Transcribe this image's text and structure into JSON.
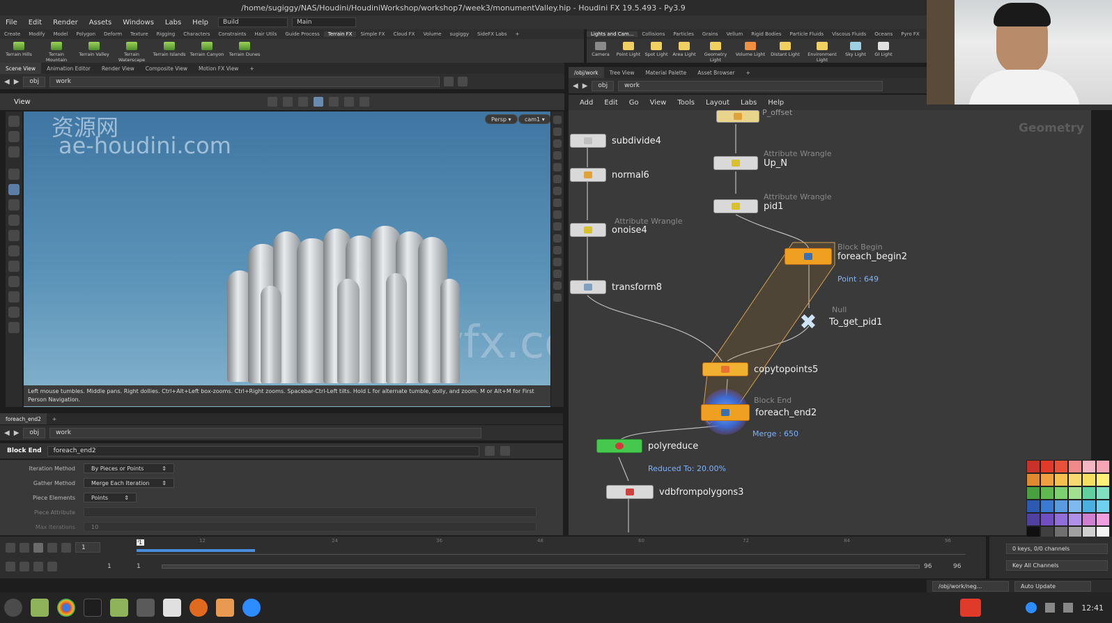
{
  "window": {
    "title": "/home/sugiggy/NAS/Houdini/HoudiniWorkshop/workshop7/week3/monumentValley.hip - Houdini FX 19.5.493 - Py3.9"
  },
  "menubar": {
    "items": [
      "File",
      "Edit",
      "Render",
      "Assets",
      "Windows",
      "Labs",
      "Help"
    ],
    "desktop": "Build",
    "context": "Main"
  },
  "shelf_left": {
    "tabs": [
      "Create",
      "Modify",
      "Model",
      "Polygon",
      "Deform",
      "Texture",
      "Rigging",
      "Characters",
      "Constraints",
      "Hair Utils",
      "Guide Process",
      "Terrain FX",
      "Simple FX",
      "Cloud FX",
      "Volume",
      "sugiggy",
      "SideFX Labs"
    ],
    "active_tab": "Terrain FX",
    "tools": [
      "Terrain Hills",
      "Terrain Mountain",
      "Terrain Valley",
      "Terrain Waterscape",
      "Terrain Islands",
      "Terrain Canyon",
      "Terrain Dunes"
    ]
  },
  "shelf_right": {
    "tabs": [
      "Lights and Cam...",
      "Collisions",
      "Particles",
      "Grains",
      "Vellum",
      "Rigid Bodies",
      "Particle Fluids",
      "Viscous Fluids",
      "Oceans",
      "Pyro FX"
    ],
    "tools": [
      "Camera",
      "Point Light",
      "Spot Light",
      "Area Light",
      "Geometry Light",
      "Volume Light",
      "Distant Light",
      "Environment Light",
      "Sky Light",
      "GI Light"
    ]
  },
  "viewer": {
    "tabs": [
      "Scene View",
      "Animation Editor",
      "Render View",
      "Composite View",
      "Motion FX View"
    ],
    "path_obj": "obj",
    "path_net": "work",
    "view_label": "View",
    "persp": "Persp",
    "cam": "cam1",
    "watermark1": "资源网",
    "watermark2": "ae-houdini.com",
    "watermark3": "illvfx.com",
    "hint_line1": "Left mouse tumbles. Middle pans. Right dollies. Ctrl+Alt+Left box-zooms. Ctrl+Right zooms. Spacebar-Ctrl-Left tilts. Hold L for alternate tumble, dolly, and zoom.     M or Alt+M for First",
    "hint_line2": "Person Navigation."
  },
  "network": {
    "tabs": [
      "/obj/work",
      "Tree View",
      "Material Palette",
      "Asset Browser"
    ],
    "path_obj": "obj",
    "path_net": "work",
    "menu": [
      "Add",
      "Edit",
      "Go",
      "View",
      "Tools",
      "Layout",
      "Labs",
      "Help"
    ],
    "context_label": "Geometry",
    "nodes": {
      "p_offset": "P_offset",
      "subdivide": "subdivide4",
      "normal": "normal6",
      "onoise_type": "Attribute Wrangle",
      "onoise": "onoise4",
      "transform": "transform8",
      "upn_type": "Attribute Wrangle",
      "upn": "Up_N",
      "pid_type": "Attribute Wrangle",
      "pid": "pid1",
      "begin_type": "Block Begin",
      "begin": "foreach_begin2",
      "begin_info": "Point : 649",
      "null_type": "Null",
      "null": "To_get_pid1",
      "copy": "copytopoints5",
      "end_type": "Block End",
      "end": "foreach_end2",
      "end_info": "Merge : 650",
      "polyreduce": "polyreduce",
      "polyreduce_info": "Reduced To: 20.00%",
      "vdb": "vdbfrompolygons3"
    }
  },
  "params": {
    "tab": "foreach_end2",
    "path_obj": "obj",
    "path_net": "work",
    "node_type": "Block End",
    "node_name": "foreach_end2",
    "rows": [
      {
        "label": "Iteration Method",
        "value": "By Pieces or Points"
      },
      {
        "label": "Gather Method",
        "value": "Merge Each Iteration"
      },
      {
        "label": "Piece Elements",
        "value": "Points"
      },
      {
        "label": "Piece Attribute",
        "value": ""
      },
      {
        "label": "Max Iterations",
        "value": "10"
      }
    ]
  },
  "timeline": {
    "frame": "1",
    "start": "1",
    "start2": "1",
    "end": "96",
    "end2": "96",
    "ticks": [
      "1",
      "12",
      "24",
      "36",
      "48",
      "60",
      "72",
      "84",
      "96"
    ],
    "keys": "0 keys, 0/0 channels",
    "key_all": "Key All Channels",
    "path": "/obj/work/neg...",
    "auto_update": "Auto Update"
  },
  "taskbar": {
    "clock": "12:41"
  },
  "colors": {
    "accent": "#f0a020",
    "info": "#7db3ff",
    "network_bg": "#3a3a3a"
  },
  "swatches": [
    "#c83228",
    "#e03a2a",
    "#e8523a",
    "#f08a8a",
    "#f4b6c2",
    "#f4a6b6",
    "#e08a30",
    "#f0a040",
    "#f4c050",
    "#f8d870",
    "#f4e060",
    "#fff07a",
    "#48a040",
    "#60b850",
    "#7cd070",
    "#a0e090",
    "#60d0a0",
    "#80e0c0",
    "#2c5ab0",
    "#3a7ad0",
    "#5a9ae0",
    "#80b8f0",
    "#4ab0e0",
    "#70d0f0",
    "#5040a0",
    "#7050c0",
    "#9070d8",
    "#b090e8",
    "#d080d0",
    "#f0a0e0",
    "#101010",
    "#404040",
    "#707070",
    "#a0a0a0",
    "#d0d0d0",
    "#f4f4f4"
  ]
}
